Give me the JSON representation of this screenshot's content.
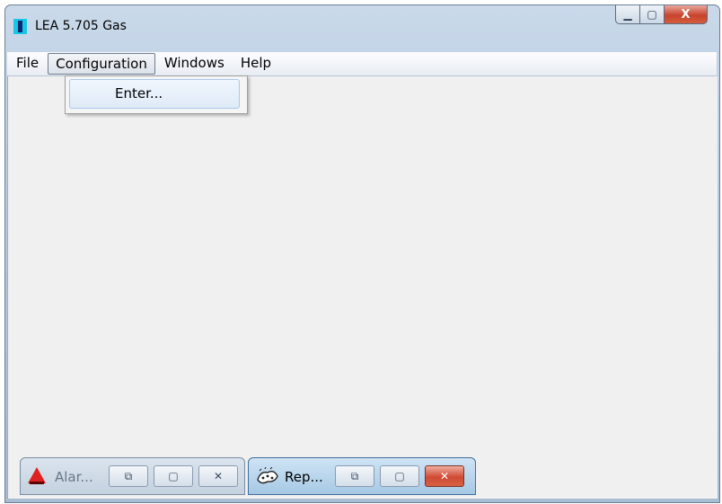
{
  "window": {
    "title": "LEA 5.705 Gas",
    "controls": {
      "minimize_glyph": "▁",
      "maximize_glyph": "▢",
      "close_glyph": "X"
    }
  },
  "menubar": {
    "items": [
      {
        "label": "File"
      },
      {
        "label": "Configuration"
      },
      {
        "label": "Windows"
      },
      {
        "label": "Help"
      }
    ]
  },
  "dropdown": {
    "items": [
      {
        "label": "Enter..."
      }
    ]
  },
  "minimized_windows": [
    {
      "title": "Alar...",
      "icon": "bell-icon",
      "active": false,
      "restore_glyph": "⧉",
      "maximize_glyph": "▢",
      "close_glyph": "✕"
    },
    {
      "title": "Rep...",
      "icon": "report-icon",
      "active": true,
      "restore_glyph": "⧉",
      "maximize_glyph": "▢",
      "close_glyph": "✕"
    }
  ],
  "colors": {
    "accent_close": "#c8432c",
    "app_icon": "#17c6e8",
    "workspace": "#f0f0f0"
  }
}
